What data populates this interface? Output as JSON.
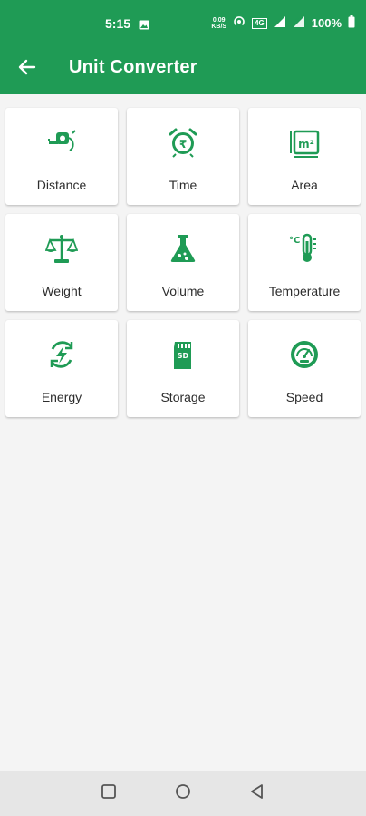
{
  "status_bar": {
    "time": "5:15",
    "speed": "0.09",
    "speed_unit": "KB/S",
    "network": "4G",
    "battery": "100%"
  },
  "app_bar": {
    "title": "Unit Converter",
    "back_icon": "arrow-left-icon",
    "background": "#1f9b55"
  },
  "accent_color": "#1f9b55",
  "tiles": [
    {
      "label": "Distance",
      "icon": "tape-measure-icon"
    },
    {
      "label": "Time",
      "icon": "alarm-clock-rupee-icon"
    },
    {
      "label": "Area",
      "icon": "area-m2-icon"
    },
    {
      "label": "Weight",
      "icon": "balance-scale-icon"
    },
    {
      "label": "Volume",
      "icon": "flask-icon"
    },
    {
      "label": "Temperature",
      "icon": "thermometer-icon"
    },
    {
      "label": "Energy",
      "icon": "energy-cycle-icon"
    },
    {
      "label": "Storage",
      "icon": "sd-card-icon"
    },
    {
      "label": "Speed",
      "icon": "speedometer-icon"
    }
  ],
  "nav_bar": {
    "buttons": [
      "recents-square-icon",
      "home-circle-icon",
      "back-triangle-icon"
    ]
  }
}
